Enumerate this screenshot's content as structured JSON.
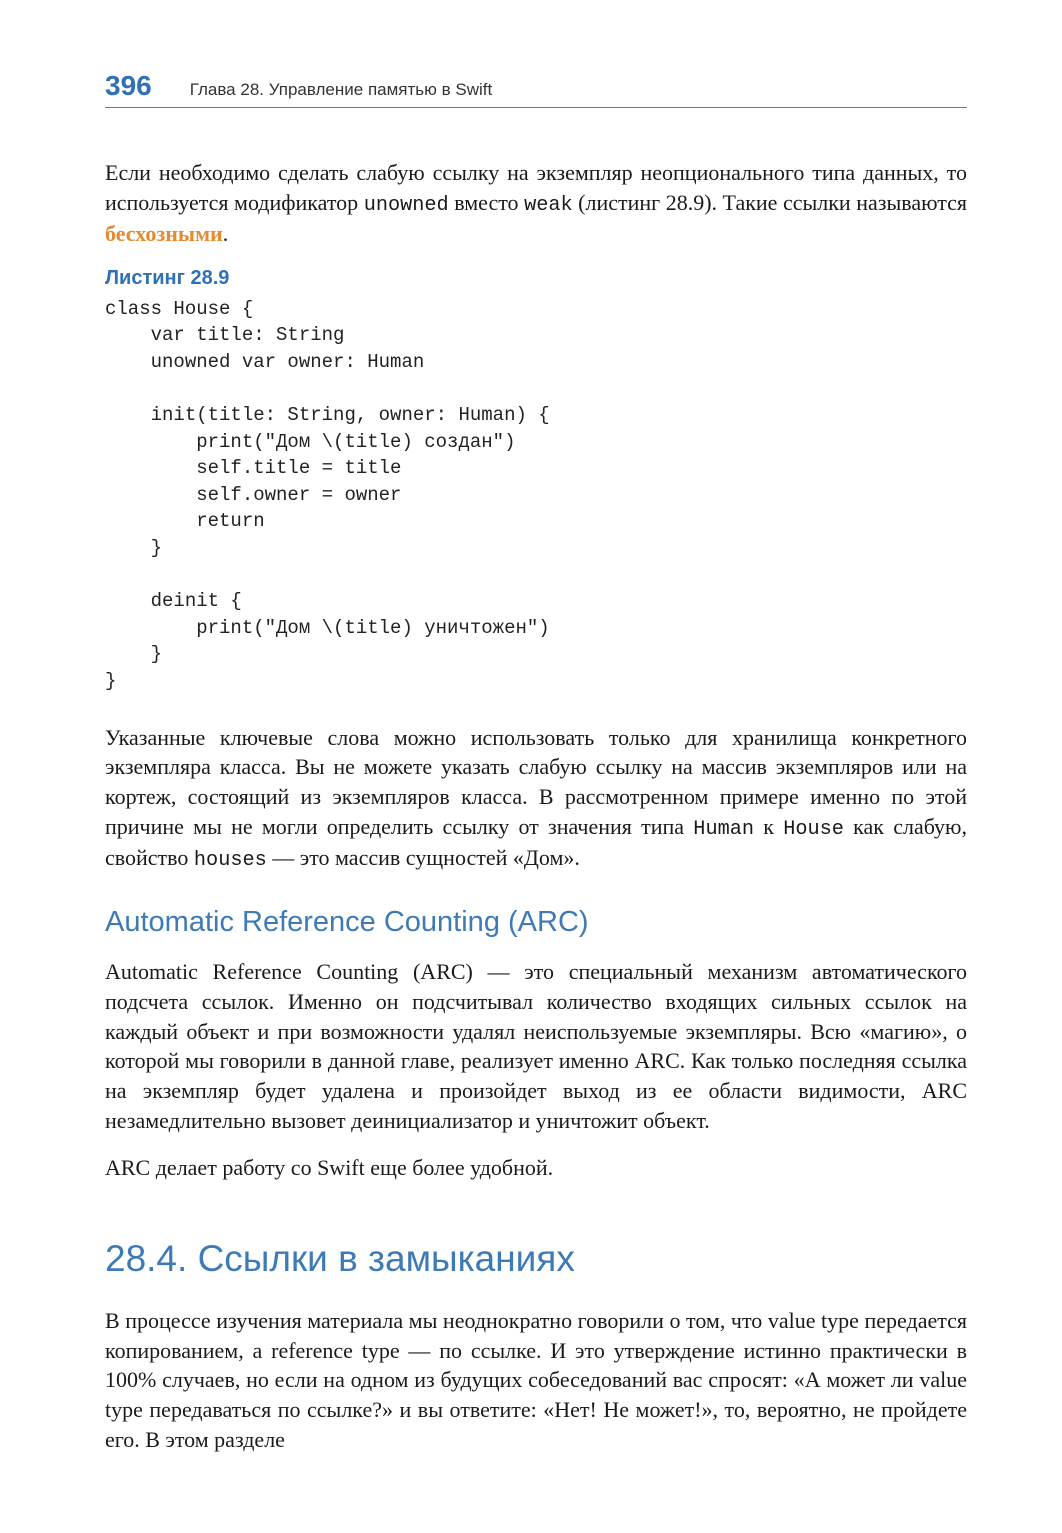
{
  "header": {
    "page_number": "396",
    "chapter": "Глава 28. Управление памятью в Swift"
  },
  "para1_before_code1": "Если необходимо сделать слабую ссылку на экземпляр неопционального типа данных, то используется модификатор ",
  "para1_code1": "unowned",
  "para1_mid": " вместо ",
  "para1_code2": "weak",
  "para1_after_code2": " (листинг 28.9). Такие ссылки называются ",
  "para1_term": "бесхозными",
  "para1_end": ".",
  "listing_label": "Листинг 28.9",
  "code": "class House {\n    var title: String\n    unowned var owner: Human\n\n    init(title: String, owner: Human) {\n        print(\"Дом \\(title) создан\")\n        self.title = title\n        self.owner = owner\n        return\n    }\n\n    deinit {\n        print(\"Дом \\(title) уничтожен\")\n    }\n}",
  "para2_p1": "Указанные ключевые слова можно использовать только для хранилища конкретного экземпляра класса. Вы не можете указать слабую ссылку на массив экземпляров или на кортеж, состоящий из экземпляров класса. В рассмотренном примере именно по этой причине мы не могли определить ссылку от значения типа ",
  "para2_c1": "Human",
  "para2_p2": " к ",
  "para2_c2": "House",
  "para2_p3": " как слабую, свойство ",
  "para2_c3": "houses",
  "para2_p4": " — это массив сущностей «Дом».",
  "h2": "Automatic Reference Counting (ARC)",
  "para3": "Automatic Reference Counting (ARC) — это специальный механизм автоматического подсчета ссылок. Именно он подсчитывал количество входящих сильных ссылок на каждый объект и при возможности удалял неиспользуемые экземпляры. Всю «магию», о которой мы говорили в данной главе, реализует именно ARC. Как только последняя ссылка на экземпляр будет удалена и произойдет выход из ее области видимости, ARC незамедлительно вызовет деинициализатор и уничтожит объект.",
  "para4": "ARC делает работу со Swift еще более удобной.",
  "h1": "28.4. Ссылки в замыканиях",
  "para5": "В процессе изучения материала мы неоднократно говорили о том, что value type передается копированием, а reference type — по ссылке. И это утверждение истинно практически в 100% случаев, но если на одном из будущих собеседований вас спросят: «А может ли value type передаваться по ссылке?» и вы ответите: «Нет! Не может!», то, вероятно, не пройдете его. В этом разделе"
}
